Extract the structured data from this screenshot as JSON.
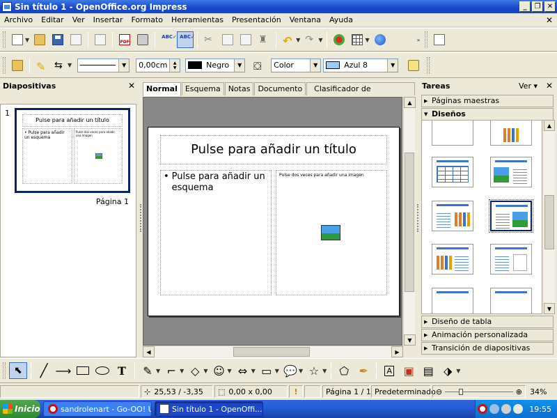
{
  "window": {
    "title": "Sin título 1 - OpenOffice.org Impress"
  },
  "menu": [
    "Archivo",
    "Editar",
    "Ver",
    "Insertar",
    "Formato",
    "Herramientas",
    "Presentación",
    "Ventana",
    "Ayuda"
  ],
  "toolbar2": {
    "line_width": "0,00cm",
    "line_color_name": "Negro",
    "line_color": "#000000",
    "fill_type": "Color",
    "fill_color_name": "Azul 8",
    "fill_color": "#99ccff"
  },
  "slides_panel": {
    "title": "Diapositivas",
    "slide_number": "1",
    "page_label": "Página 1",
    "thumb": {
      "title": "Pulse para añadir un título",
      "outline": "• Pulse para añadir un esquema",
      "image_text": "Pulse dos veces para añadir una imagen"
    }
  },
  "tabs": [
    "Normal",
    "Esquema",
    "Notas",
    "Documento",
    "Clasificador de diapositivas"
  ],
  "slide": {
    "title_placeholder": "Pulse para añadir un título",
    "outline_placeholder": "Pulse para añadir un esquema",
    "image_placeholder": "Pulse dos veces para añadir una imagen"
  },
  "tasks_panel": {
    "title": "Tareas",
    "view_label": "Ver",
    "sections": [
      "Páginas maestras",
      "Diseños",
      "Diseño de tabla",
      "Animación personalizada",
      "Transición de diapositivas"
    ]
  },
  "status": {
    "position": "25,53 / -3,35",
    "size": "0,00 x 0,00",
    "page": "Página 1 / 1",
    "master": "Predeterminado",
    "zoom": "34%"
  },
  "taskbar": {
    "start": "Inicio",
    "tasks": [
      "sandrolenart - Go-OO! U...",
      "Sin título 1 - OpenOffi..."
    ],
    "clock": "19:55"
  }
}
